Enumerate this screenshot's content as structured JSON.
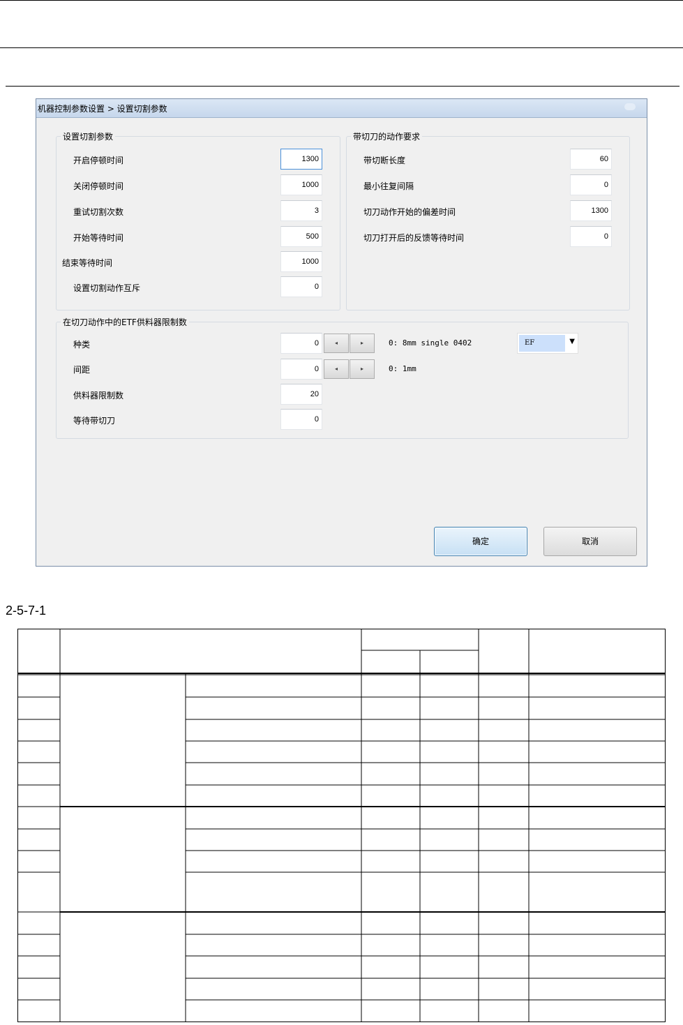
{
  "dialog": {
    "title": "机器控制参数设置 > 设置切割参数",
    "group_cut": {
      "legend": "设置切割参数",
      "fields": [
        {
          "label": "开启停顿时间",
          "value": "1300"
        },
        {
          "label": "关闭停顿时间",
          "value": "1000"
        },
        {
          "label": "重试切割次数",
          "value": "3"
        },
        {
          "label": "开始等待时间",
          "value": "500"
        },
        {
          "label": "结束等待时间",
          "value": "1000"
        },
        {
          "label": "设置切割动作互斥",
          "value": "0"
        }
      ]
    },
    "group_blade": {
      "legend": "带切刀的动作要求",
      "fields": [
        {
          "label": "带切断长度",
          "value": "60"
        },
        {
          "label": "最小往复间隔",
          "value": "0"
        },
        {
          "label": "切刀动作开始的偏差时间",
          "value": "1300"
        },
        {
          "label": "切刀打开后的反馈等待时间",
          "value": "0"
        }
      ]
    },
    "group_etf": {
      "legend": "在切刀动作中的ETF供料器限制数",
      "fields": [
        {
          "label": "种类",
          "value": "0",
          "info": "0:  8mm single 0402"
        },
        {
          "label": "间距",
          "value": "0",
          "info": "0: 1mm"
        },
        {
          "label": "供料器限制数",
          "value": "20"
        },
        {
          "label": "等待带切刀",
          "value": "0"
        }
      ],
      "combo_value": "EF",
      "spin_left": "◂",
      "spin_right": "▸"
    },
    "ok_label": "确定",
    "cancel_label": "取消"
  },
  "caption": "2-5-7-1"
}
